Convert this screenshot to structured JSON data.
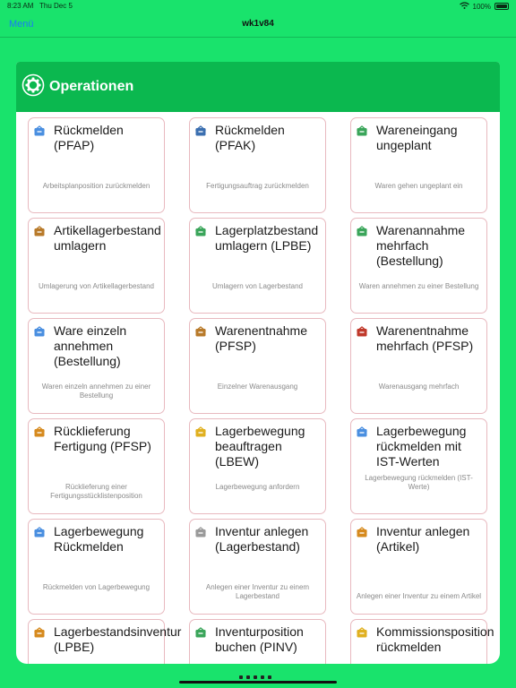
{
  "statusbar": {
    "time": "8:23 AM",
    "date": "Thu Dec 5",
    "battery": "100%"
  },
  "navbar": {
    "back_label": "Menü",
    "title": "wk1v84"
  },
  "panel": {
    "title": "Operationen",
    "icon": "gear-icon"
  },
  "tiles": [
    {
      "label": "Rückmelden (PFAP)",
      "desc": "Arbeitsplanposition zurückmelden",
      "icon": "hand-icon",
      "color": "#4a8fe0"
    },
    {
      "label": "Rückmelden (PFAK)",
      "desc": "Fertigungsauftrag zurückmelden",
      "icon": "machine-icon",
      "color": "#3b6fb0"
    },
    {
      "label": "Wareneingang ungeplant",
      "desc": "Waren gehen ungeplant ein",
      "icon": "box-in-icon",
      "color": "#3aa55a"
    },
    {
      "label": "Artikellagerbestand umlagern",
      "desc": "Umlagerung von Artikellagerbestand",
      "icon": "crate-icon",
      "color": "#b87a2a"
    },
    {
      "label": "Lagerplatzbestand umlagern (LPBE)",
      "desc": "Umlagern von Lagerbestand",
      "icon": "transfer-icon",
      "color": "#3aa55a"
    },
    {
      "label": "Warenannahme mehrfach (Bestellung)",
      "desc": "Waren annehmen zu einer Bestellung",
      "icon": "box-in-icon",
      "color": "#3aa55a"
    },
    {
      "label": "Ware einzeln annehmen (Bestellung)",
      "desc": "Waren einzeln annehmen zu einer Bestellung",
      "icon": "box-up-icon",
      "color": "#4a8fe0"
    },
    {
      "label": "Warenentnahme (PFSP)",
      "desc": "Einzelner Warenausgang",
      "icon": "crate-icon",
      "color": "#b87a2a"
    },
    {
      "label": "Warenentnahme mehrfach (PFSP)",
      "desc": "Warenausgang mehrfach",
      "icon": "truck-icon",
      "color": "#c0392b"
    },
    {
      "label": "Rücklieferung Fertigung (PFSP)",
      "desc": "Rücklieferung einer Fertigungsstücklistenposition",
      "icon": "truck-icon",
      "color": "#d68a1e"
    },
    {
      "label": "Lagerbewegung beauftragen (LBEW)",
      "desc": "Lagerbewegung anfordern",
      "icon": "order-icon",
      "color": "#e0b020"
    },
    {
      "label": "Lagerbewegung rückmelden mit IST-Werten",
      "desc": "Lagerbewegung rückmelden (IST-Werte)",
      "icon": "report-icon",
      "color": "#4a8fe0"
    },
    {
      "label": "Lagerbewegung Rückmelden",
      "desc": "Rückmelden von Lagerbewegung",
      "icon": "move-icon",
      "color": "#4a8fe0"
    },
    {
      "label": "Inventur anlegen (Lagerbestand)",
      "desc": "Anlegen einer Inventur zu einem Lagerbestand",
      "icon": "document-icon",
      "color": "#9a9a9a"
    },
    {
      "label": "Inventur anlegen (Artikel)",
      "desc": "Anlegen einer Inventur zu einem Artikel",
      "icon": "document-icon",
      "color": "#d68a1e"
    },
    {
      "label": "Lagerbestandsinventur (LPBE)",
      "desc": "",
      "icon": "inventory-icon",
      "color": "#d68a1e"
    },
    {
      "label": "Inventurposition buchen (PINV)",
      "desc": "",
      "icon": "book-icon",
      "color": "#3aa55a"
    },
    {
      "label": "Kommissionsposition rückmelden",
      "desc": "",
      "icon": "commission-icon",
      "color": "#e0b020"
    }
  ]
}
